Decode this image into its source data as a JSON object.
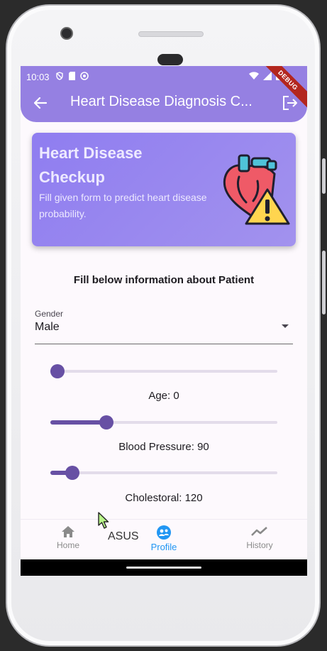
{
  "status_bar": {
    "time": "10:03"
  },
  "debug_ribbon": "DEBUG",
  "app_bar": {
    "title": "Heart Disease Diagnosis C..."
  },
  "banner": {
    "title": "Heart Disease Checkup",
    "subtitle": "Fill given form to predict heart disease probability."
  },
  "form": {
    "heading": "Fill below information about Patient",
    "gender": {
      "label": "Gender",
      "value": "Male"
    },
    "sliders": [
      {
        "label": "Age: 0",
        "fraction": 0.0
      },
      {
        "label": "Blood Pressure: 90",
        "fraction": 0.23
      },
      {
        "label": "Cholestoral: 120",
        "fraction": 0.07
      }
    ]
  },
  "bottom_nav": {
    "items": [
      {
        "label": "Home",
        "icon": "home-icon",
        "active": false
      },
      {
        "label": "Profile",
        "icon": "profile-icon",
        "active": true
      },
      {
        "label": "History",
        "icon": "history-icon",
        "active": false
      }
    ]
  },
  "overlay_text": "ASUS",
  "colors": {
    "primary": "#9580e2",
    "slider": "#6750a4",
    "active_nav": "#2196f3",
    "debug": "#b3261e"
  }
}
